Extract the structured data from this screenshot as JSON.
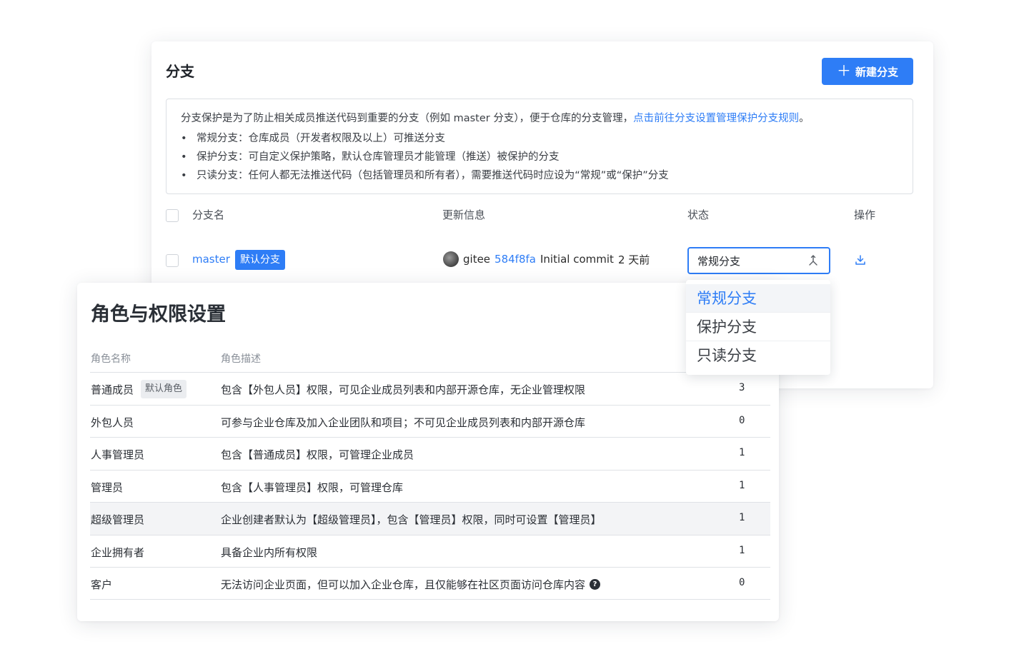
{
  "branch": {
    "title": "分支",
    "new_button": "新建分支",
    "info": {
      "intro": "分支保护是为了防止相关成员推送代码到重要的分支（例如 master 分支），便于仓库的分支管理，",
      "link": "点击前往分支设置管理保护分支规则",
      "link_suffix": "。",
      "bullets": [
        "常规分支：仓库成员（开发者权限及以上）可推送分支",
        "保护分支：可自定义保护策略，默认仓库管理员才能管理（推送）被保护的分支",
        "只读分支：任何人都无法推送代码（包括管理员和所有者），需要推送代码时应设为“常规”或“保护”分支"
      ]
    },
    "columns": {
      "name": "分支名",
      "update": "更新信息",
      "status": "状态",
      "action": "操作"
    },
    "row": {
      "name": "master",
      "badge": "默认分支",
      "author": "gitee",
      "hash": "584f8fa",
      "message": "Initial commit",
      "time": "2 天前",
      "status": "常规分支"
    },
    "dropdown": [
      "常规分支",
      "保护分支",
      "只读分支"
    ]
  },
  "roles": {
    "title": "角色与权限设置",
    "columns": {
      "name": "角色名称",
      "desc": "角色描述"
    },
    "rows": [
      {
        "name": "普通成员",
        "badge": "默认角色",
        "desc": "包含【外包人员】权限，可见企业成员列表和内部开源仓库，无企业管理权限",
        "count": "3"
      },
      {
        "name": "外包人员",
        "desc": "可参与企业仓库及加入企业团队和项目；不可见企业成员列表和内部开源仓库",
        "count": "0"
      },
      {
        "name": "人事管理员",
        "desc": "包含【普通成员】权限，可管理企业成员",
        "count": "1"
      },
      {
        "name": "管理员",
        "desc": "包含【人事管理员】权限，可管理仓库",
        "count": "1"
      },
      {
        "name": "超级管理员",
        "desc": "企业创建者默认为【超级管理员】，包含【管理员】权限，同时可设置【管理员】",
        "count": "1"
      },
      {
        "name": "企业拥有者",
        "desc": "具备企业内所有权限",
        "count": "1"
      },
      {
        "name": "客户",
        "desc": "无法访问企业页面，但可以加入企业仓库，且仅能够在社区页面访问仓库内容",
        "count": "0"
      }
    ]
  }
}
